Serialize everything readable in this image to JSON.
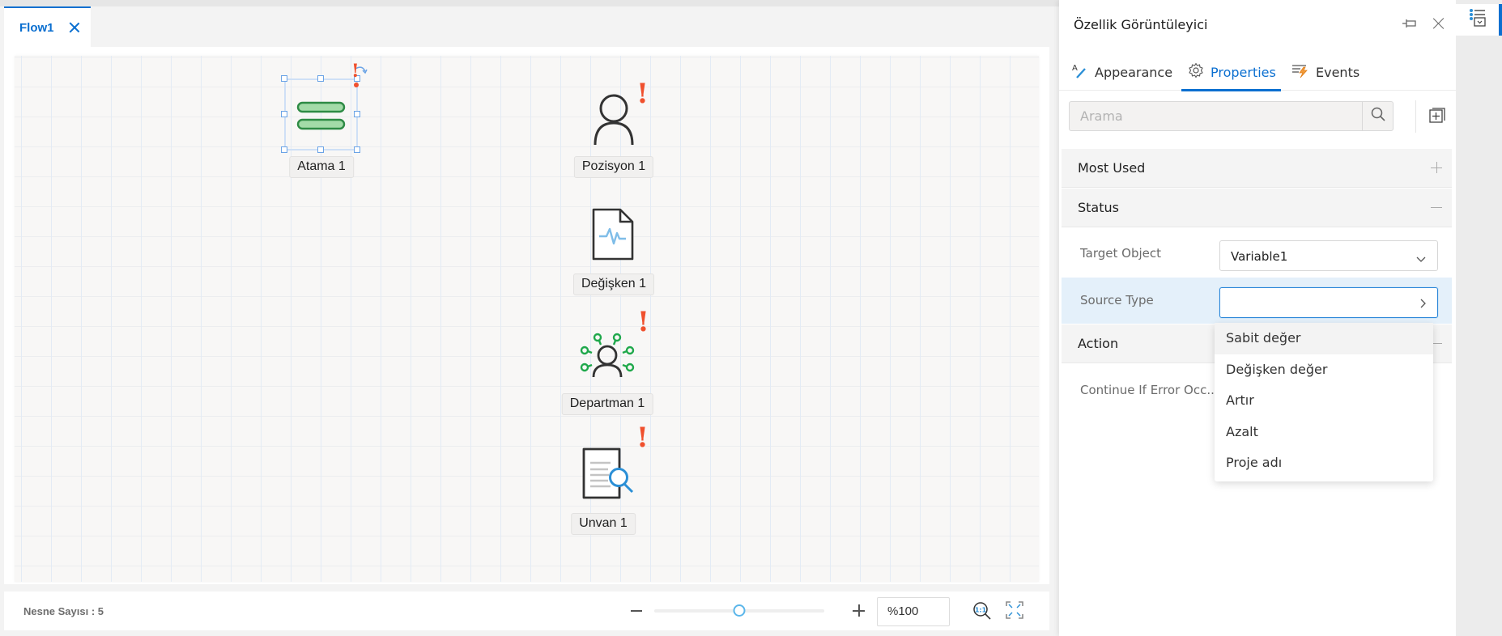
{
  "document_tab": {
    "label": "Flow1"
  },
  "nodes": [
    {
      "id": "atama",
      "label": "Atama 1",
      "icon": "assignment-icon",
      "selected": true,
      "warning": true
    },
    {
      "id": "pozisyon",
      "label": "Pozisyon 1",
      "icon": "person-icon",
      "selected": false,
      "warning": true
    },
    {
      "id": "degisken",
      "label": "Değişken 1",
      "icon": "variable-document-icon",
      "selected": false,
      "warning": false
    },
    {
      "id": "departman",
      "label": "Departman 1",
      "icon": "department-icon",
      "selected": false,
      "warning": true
    },
    {
      "id": "unvan",
      "label": "Unvan 1",
      "icon": "title-search-document-icon",
      "selected": false,
      "warning": true
    }
  ],
  "warning_glyph": "!",
  "statusbar": {
    "object_count_label": "Nesne Sayısı : 5",
    "zoom_value": "%100",
    "zoom_slider_fraction": 0.5
  },
  "panel": {
    "title": "Özellik Görüntüleyici",
    "tabs": [
      {
        "label": "Appearance",
        "active": false
      },
      {
        "label": "Properties",
        "active": true
      },
      {
        "label": "Events",
        "active": false
      }
    ],
    "search": {
      "placeholder": "Arama",
      "value": ""
    },
    "sections": [
      {
        "title": "Most Used",
        "expanded": false
      },
      {
        "title": "Status",
        "expanded": true
      },
      {
        "title": "Action",
        "expanded": true
      }
    ],
    "properties": {
      "target_object": {
        "label": "Target Object",
        "value": "Variable1"
      },
      "source_type": {
        "label": "Source Type",
        "value": ""
      },
      "continue_on_error": {
        "label": "Continue If Error Occ..."
      }
    },
    "source_type_options": [
      "Sabit değer",
      "Değişken değer",
      "Artır",
      "Azalt",
      "Proje adı"
    ],
    "hovered_option": "Sabit değer"
  },
  "colors": {
    "accent": "#0b6fd0",
    "warning": "#f0502d",
    "node_green": "#2e8b45",
    "node_green_fill": "#a3dba8",
    "icon_blue": "#2b8fd6"
  }
}
